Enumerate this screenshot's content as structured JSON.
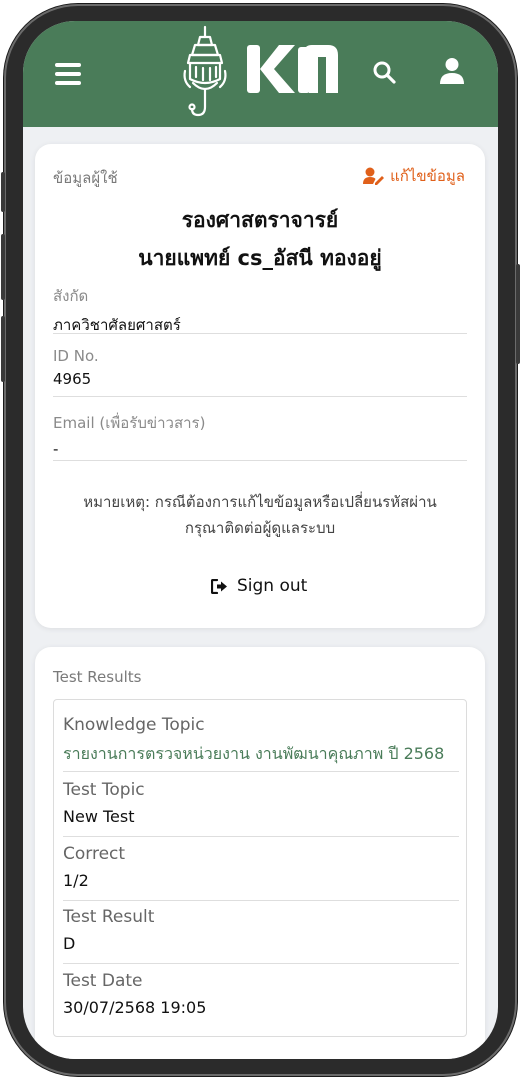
{
  "brand": {
    "logo_text": "KM",
    "header_color": "#4a7c59",
    "accent_color": "#e0601a"
  },
  "header": {
    "menu_icon": "hamburger-menu-icon",
    "search_icon": "search-icon",
    "user_icon": "user-icon"
  },
  "profile": {
    "section_label": "ข้อมูลผู้ใช้",
    "edit_label": "แก้ไขข้อมูล",
    "title_line1": "รองศาสตราจารย์",
    "title_line2": "นายแพทย์ cs_อัสนี ทองอยู่",
    "fields": [
      {
        "label": "สังกัด",
        "value": "ภาควิชาศัลยศาสตร์"
      },
      {
        "label": "ID No.",
        "value": "4965"
      },
      {
        "label": "Email (เพื่อรับข่าวสาร)",
        "value": "-"
      }
    ],
    "note_line1": "หมายเหตุ: กรณีต้องการแก้ไขข้อมูลหรือเปลี่ยนรหัสผ่าน",
    "note_line2": "กรุณาติดต่อผู้ดูแลระบบ",
    "signout_label": "Sign out"
  },
  "results": {
    "section_label": "Test Results",
    "rows": [
      {
        "label": "Knowledge Topic",
        "value": "รายงานการตรวจหน่วยงาน งานพัฒนาคุณภาพ ปี 2568"
      },
      {
        "label": "Test Topic",
        "value": "New Test"
      },
      {
        "label": "Correct",
        "value": "1/2"
      },
      {
        "label": "Test Result",
        "value": "D"
      },
      {
        "label": "Test Date",
        "value": "30/07/2568 19:05"
      }
    ]
  }
}
